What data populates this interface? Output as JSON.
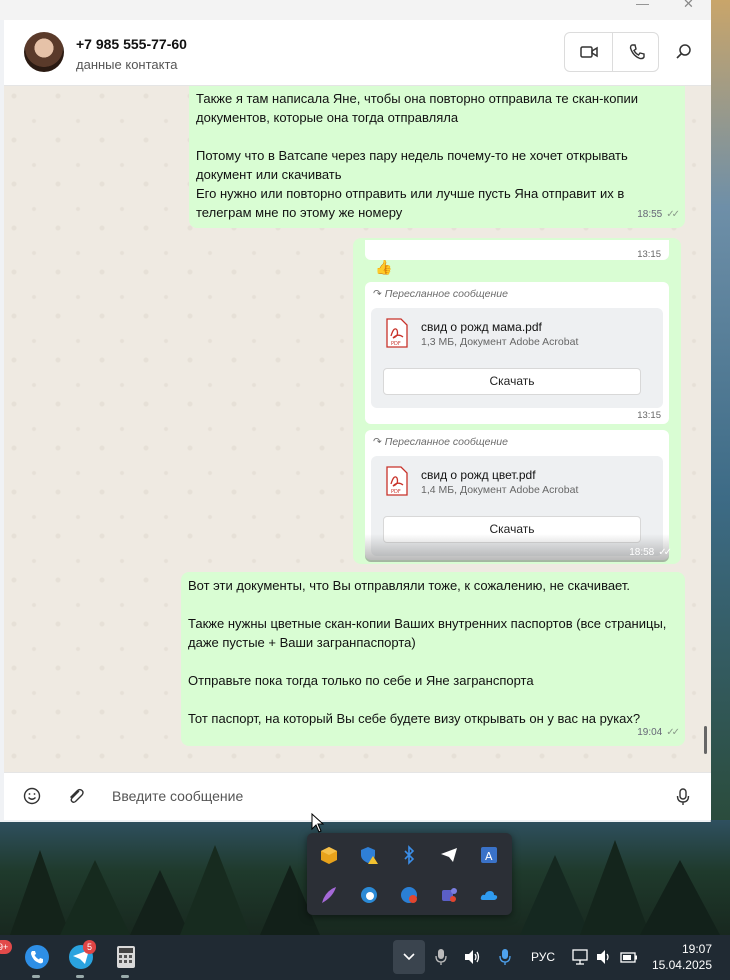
{
  "header": {
    "contact_name": "+7 985 555-77-60",
    "contact_subtitle": "данные контакта"
  },
  "messages": [
    {
      "text": "Также я там написала Яне, чтобы она повторно отправила те скан-копии документов, которые она тогда отправляла\n\nПотому что в Ватсапе через пару недель почему-то не хочет открывать документ или скачивать\nЕго нужно или повторно отправить или лучше пусть Яна отправит их в телеграм мне по этому же номеру",
      "time": "18:55"
    },
    {
      "text": "Вот эти документы, что Вы отправляли тоже, к сожалению, не скачивает.\n\nТакже нужны цветные скан-копии Ваших внутренних паспортов (все страницы, даже пустые + Ваши загранпаспорта)\n\nОтправьте пока тогда только по себе и Яне загранспорта\n\nТот паспорт, на который Вы себе будете визу открывать он у вас на руках?",
      "time": "19:04"
    }
  ],
  "forwarded_bundle": {
    "time": "18:58",
    "top_time": "13:15",
    "reaction": "👍",
    "items": [
      {
        "forwarded_label": "Пересланное сообщение",
        "file_name": "свид о рожд мама.pdf",
        "file_info": "1,3 МБ, Документ Adobe Acrobat",
        "download_label": "Скачать",
        "time": "13:15"
      },
      {
        "forwarded_label": "Пересланное сообщение",
        "file_name": "свид о рожд цвет.pdf",
        "file_info": "1,4 МБ, Документ Adobe Acrobat",
        "download_label": "Скачать"
      }
    ]
  },
  "composer": {
    "placeholder": "Введите сообщение"
  },
  "taskbar": {
    "language": "РУС",
    "time": "19:07",
    "date": "15.04.2025",
    "telegram_badge": "5",
    "left_badge": "9+"
  },
  "colors": {
    "outgoing_bubble": "#d9fdd3",
    "chat_background": "#efeae2",
    "taskbar": "#202a33"
  }
}
